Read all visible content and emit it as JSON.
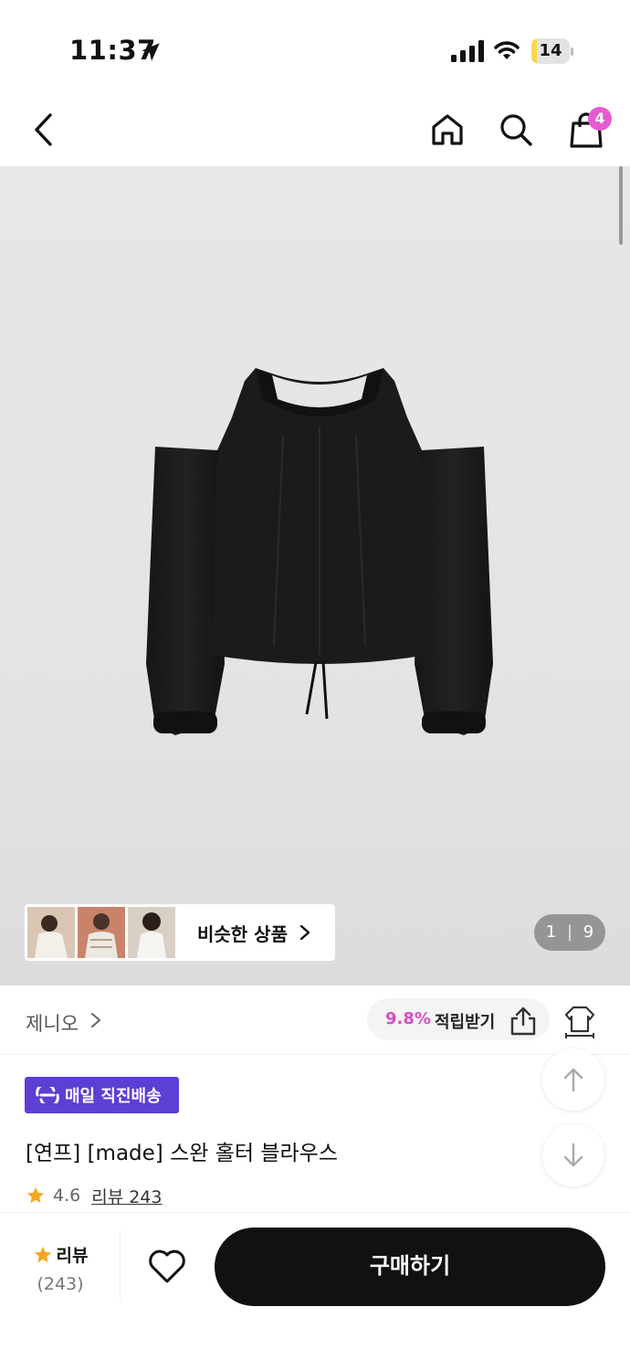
{
  "status_bar": {
    "time": "11:37",
    "battery_level": "14",
    "battery_fraction": 0.14,
    "icons": [
      "location-arrow-icon",
      "cellular-signal-icon",
      "wifi-icon",
      "battery-icon"
    ]
  },
  "nav": {
    "icons": [
      "back-arrow-icon",
      "home-icon",
      "search-icon",
      "shopping-bag-icon"
    ],
    "cart_count": "4"
  },
  "gallery": {
    "similar_label": "비슷한 상품",
    "page_current": "1",
    "page_separator": "|",
    "page_total": "9"
  },
  "brand_row": {
    "brand": "제니오",
    "points_pct": "9.8%",
    "points_label": "적립받기"
  },
  "product": {
    "delivery_badge": "매일 직진배송",
    "title": "[연프] [made] 스완 홀터 블라우스",
    "rating": "4.6",
    "review_link": "리뷰 243"
  },
  "bottom_bar": {
    "review_label": "리뷰",
    "review_count": "(243)",
    "buy_label": "구매하기"
  },
  "colors": {
    "accent_pink": "#e65ad0",
    "badge_purple": "#5d3fd3",
    "star": "#f5a623",
    "buy_button": "#111111"
  }
}
